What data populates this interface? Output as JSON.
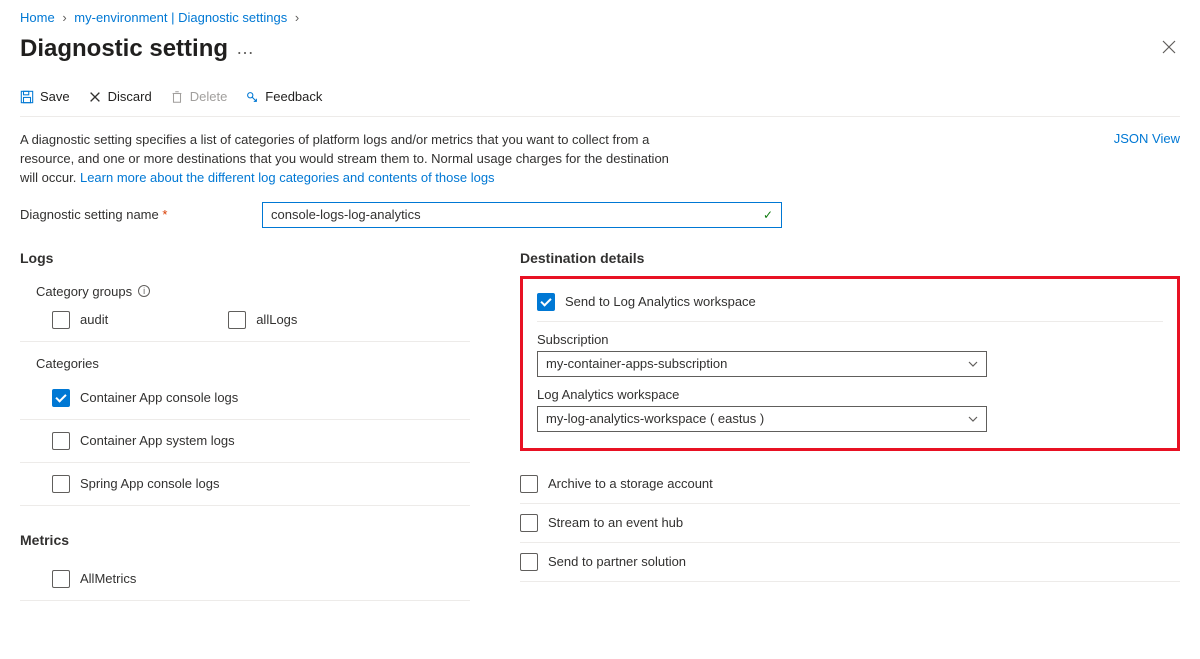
{
  "breadcrumb": {
    "home": "Home",
    "mid": "my-environment | Diagnostic settings"
  },
  "title": "Diagnostic setting",
  "toolbar": {
    "save": "Save",
    "discard": "Discard",
    "delete": "Delete",
    "feedback": "Feedback"
  },
  "json_view": "JSON View",
  "description_text": "A diagnostic setting specifies a list of categories of platform logs and/or metrics that you want to collect from a resource, and one or more destinations that you would stream them to. Normal usage charges for the destination will occur. ",
  "description_link": "Learn more about the different log categories and contents of those logs",
  "name_field": {
    "label": "Diagnostic setting name",
    "value": "console-logs-log-analytics"
  },
  "logs": {
    "heading": "Logs",
    "category_groups_label": "Category groups",
    "audit": "audit",
    "all_logs": "allLogs",
    "categories_label": "Categories",
    "console_logs": "Container App console logs",
    "system_logs": "Container App system logs",
    "spring_logs": "Spring App console logs"
  },
  "metrics": {
    "heading": "Metrics",
    "all_metrics": "AllMetrics"
  },
  "dest": {
    "heading": "Destination details",
    "law": "Send to Log Analytics workspace",
    "subscription_label": "Subscription",
    "subscription_value": "my-container-apps-subscription",
    "workspace_label": "Log Analytics workspace",
    "workspace_value": "my-log-analytics-workspace ( eastus )",
    "archive": "Archive to a storage account",
    "eventhub": "Stream to an event hub",
    "partner": "Send to partner solution"
  }
}
